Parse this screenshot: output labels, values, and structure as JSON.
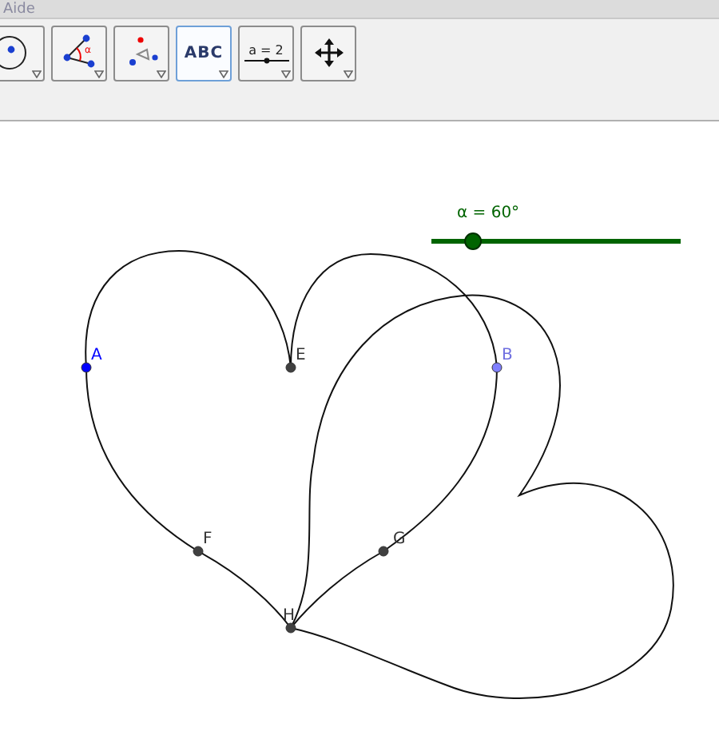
{
  "menu_bar": {
    "items": [
      "Aide"
    ]
  },
  "toolbar": {
    "tools": [
      {
        "kind": "circle",
        "selected": false
      },
      {
        "kind": "angle",
        "label": "α",
        "selected": false
      },
      {
        "kind": "rotate",
        "selected": false
      },
      {
        "kind": "text",
        "label": "ABC",
        "selected": true
      },
      {
        "kind": "slider",
        "label": "a = 2",
        "selected": false
      },
      {
        "kind": "move",
        "selected": false
      }
    ]
  },
  "canvas": {
    "slider": {
      "label": "α = 60°",
      "level": 0.167
    },
    "points": [
      {
        "name": "A",
        "color": "#0000ff"
      },
      {
        "name": "E",
        "color": "#404040"
      },
      {
        "name": "B",
        "color": "#7f7fff"
      },
      {
        "name": "F",
        "color": "#404040"
      },
      {
        "name": "G",
        "color": "#404040"
      },
      {
        "name": "H",
        "color": "#404040"
      }
    ]
  }
}
